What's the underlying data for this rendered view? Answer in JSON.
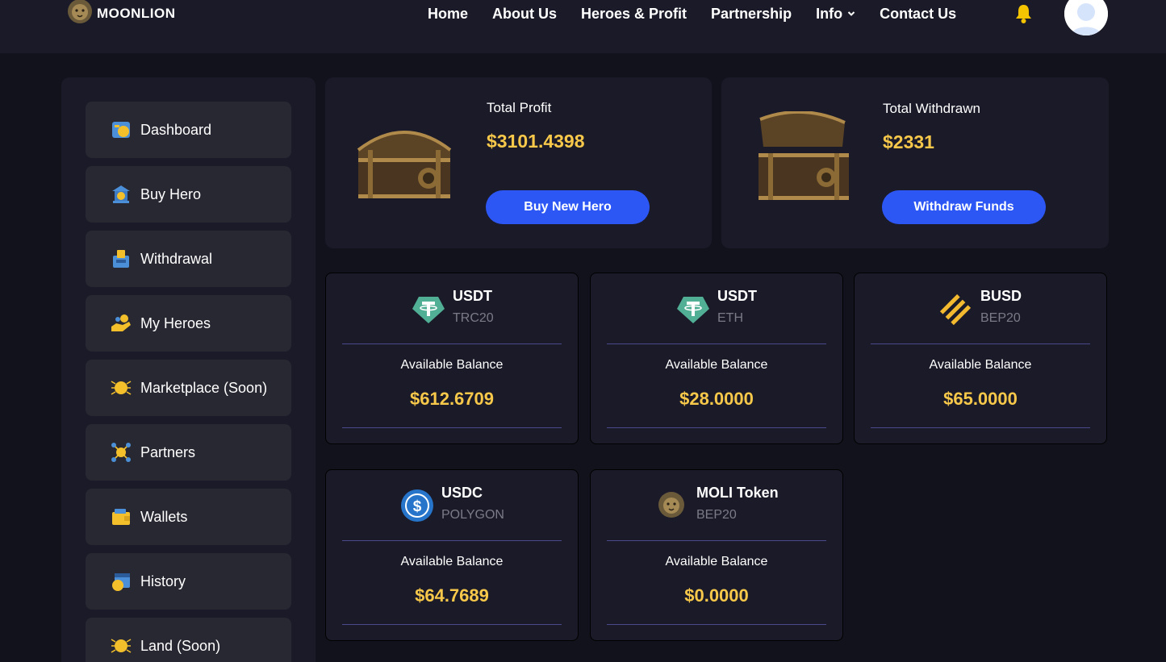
{
  "brand": {
    "name": "MOONLION"
  },
  "nav": {
    "home": "Home",
    "about": "About Us",
    "heroes": "Heroes & Profit",
    "partnership": "Partnership",
    "info": "Info",
    "contact": "Contact Us"
  },
  "icons": {
    "logo": "lion-logo-icon",
    "bell": "bell-icon",
    "avatar": "user-avatar-icon",
    "dropdown": "chevron-down-icon"
  },
  "colors": {
    "accent": "#2d57f5",
    "gold": "#f7c84a",
    "bell": "#f5c400",
    "tether": "#50af95",
    "binance": "#f3ba2f",
    "usdc": "#2775ca"
  },
  "sidebar": {
    "items": [
      {
        "label": "Dashboard",
        "icon": "dashboard-icon"
      },
      {
        "label": "Buy Hero",
        "icon": "bank-icon"
      },
      {
        "label": "Withdrawal",
        "icon": "atm-icon"
      },
      {
        "label": "My Heroes",
        "icon": "hand-coins-icon"
      },
      {
        "label": "Marketplace (Soon)",
        "icon": "coin-circuit-icon"
      },
      {
        "label": "Partners",
        "icon": "network-icon"
      },
      {
        "label": "Wallets",
        "icon": "wallet-icon"
      },
      {
        "label": "History",
        "icon": "calendar-coin-icon"
      },
      {
        "label": "Land (Soon)",
        "icon": "coin-circuit-icon"
      }
    ]
  },
  "summary": {
    "profit": {
      "label": "Total Profit",
      "value": "$3101.4398",
      "button": "Buy New Hero",
      "icon": "closed-chest-icon"
    },
    "withdrawn": {
      "label": "Total Withdrawn",
      "value": "$2331",
      "button": "Withdraw Funds",
      "icon": "open-chest-icon"
    }
  },
  "balances": [
    {
      "coin": "USDT",
      "network": "TRC20",
      "label": "Available Balance",
      "value": "$612.6709",
      "icon": "tether-icon"
    },
    {
      "coin": "USDT",
      "network": "ETH",
      "label": "Available Balance",
      "value": "$28.0000",
      "icon": "tether-icon"
    },
    {
      "coin": "BUSD",
      "network": "BEP20",
      "label": "Available Balance",
      "value": "$65.0000",
      "icon": "binance-icon"
    },
    {
      "coin": "USDC",
      "network": "POLYGON",
      "label": "Available Balance",
      "value": "$64.7689",
      "icon": "usdc-icon"
    },
    {
      "coin": "MOLI Token",
      "network": "BEP20",
      "label": "Available Balance",
      "value": "$0.0000",
      "icon": "moli-lion-icon"
    }
  ]
}
